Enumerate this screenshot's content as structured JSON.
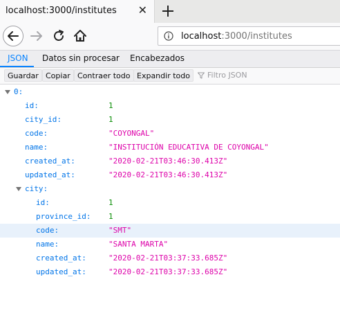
{
  "tab": {
    "title": "localhost:3000/institutes"
  },
  "url": {
    "host": "localhost",
    "rest": ":3000/institutes"
  },
  "viewer_tabs": [
    "JSON",
    "Datos sin procesar",
    "Encabezados"
  ],
  "toolbar": {
    "save": "Guardar",
    "copy": "Copiar",
    "collapse": "Contraer todo",
    "expand": "Expandir todo",
    "filter_placeholder": "Filtro JSON"
  },
  "colors": {
    "accent": "#0a84ff",
    "key": "#0074e8",
    "string": "#dd00a9",
    "number": "#058b00"
  },
  "tree": {
    "root": "0:",
    "institute": [
      {
        "key": "id:",
        "value": "1",
        "type": "num"
      },
      {
        "key": "city_id:",
        "value": "1",
        "type": "num"
      },
      {
        "key": "code:",
        "value": "\"COYONGAL\"",
        "type": "str"
      },
      {
        "key": "name:",
        "value": "\"INSTITUCIÓN EDUCATIVA DE COYONGAL\"",
        "type": "str"
      },
      {
        "key": "created_at:",
        "value": "\"2020-02-21T03:46:30.413Z\"",
        "type": "str"
      },
      {
        "key": "updated_at:",
        "value": "\"2020-02-21T03:46:30.413Z\"",
        "type": "str"
      }
    ],
    "city_key": "city:",
    "city": [
      {
        "key": "id:",
        "value": "1",
        "type": "num"
      },
      {
        "key": "province_id:",
        "value": "1",
        "type": "num"
      },
      {
        "key": "code:",
        "value": "\"SMT\"",
        "type": "str"
      },
      {
        "key": "name:",
        "value": "\"SANTA MARTA\"",
        "type": "str"
      },
      {
        "key": "created_at:",
        "value": "\"2020-02-21T03:37:33.685Z\"",
        "type": "str"
      },
      {
        "key": "updated_at:",
        "value": "\"2020-02-21T03:37:33.685Z\"",
        "type": "str"
      }
    ]
  }
}
